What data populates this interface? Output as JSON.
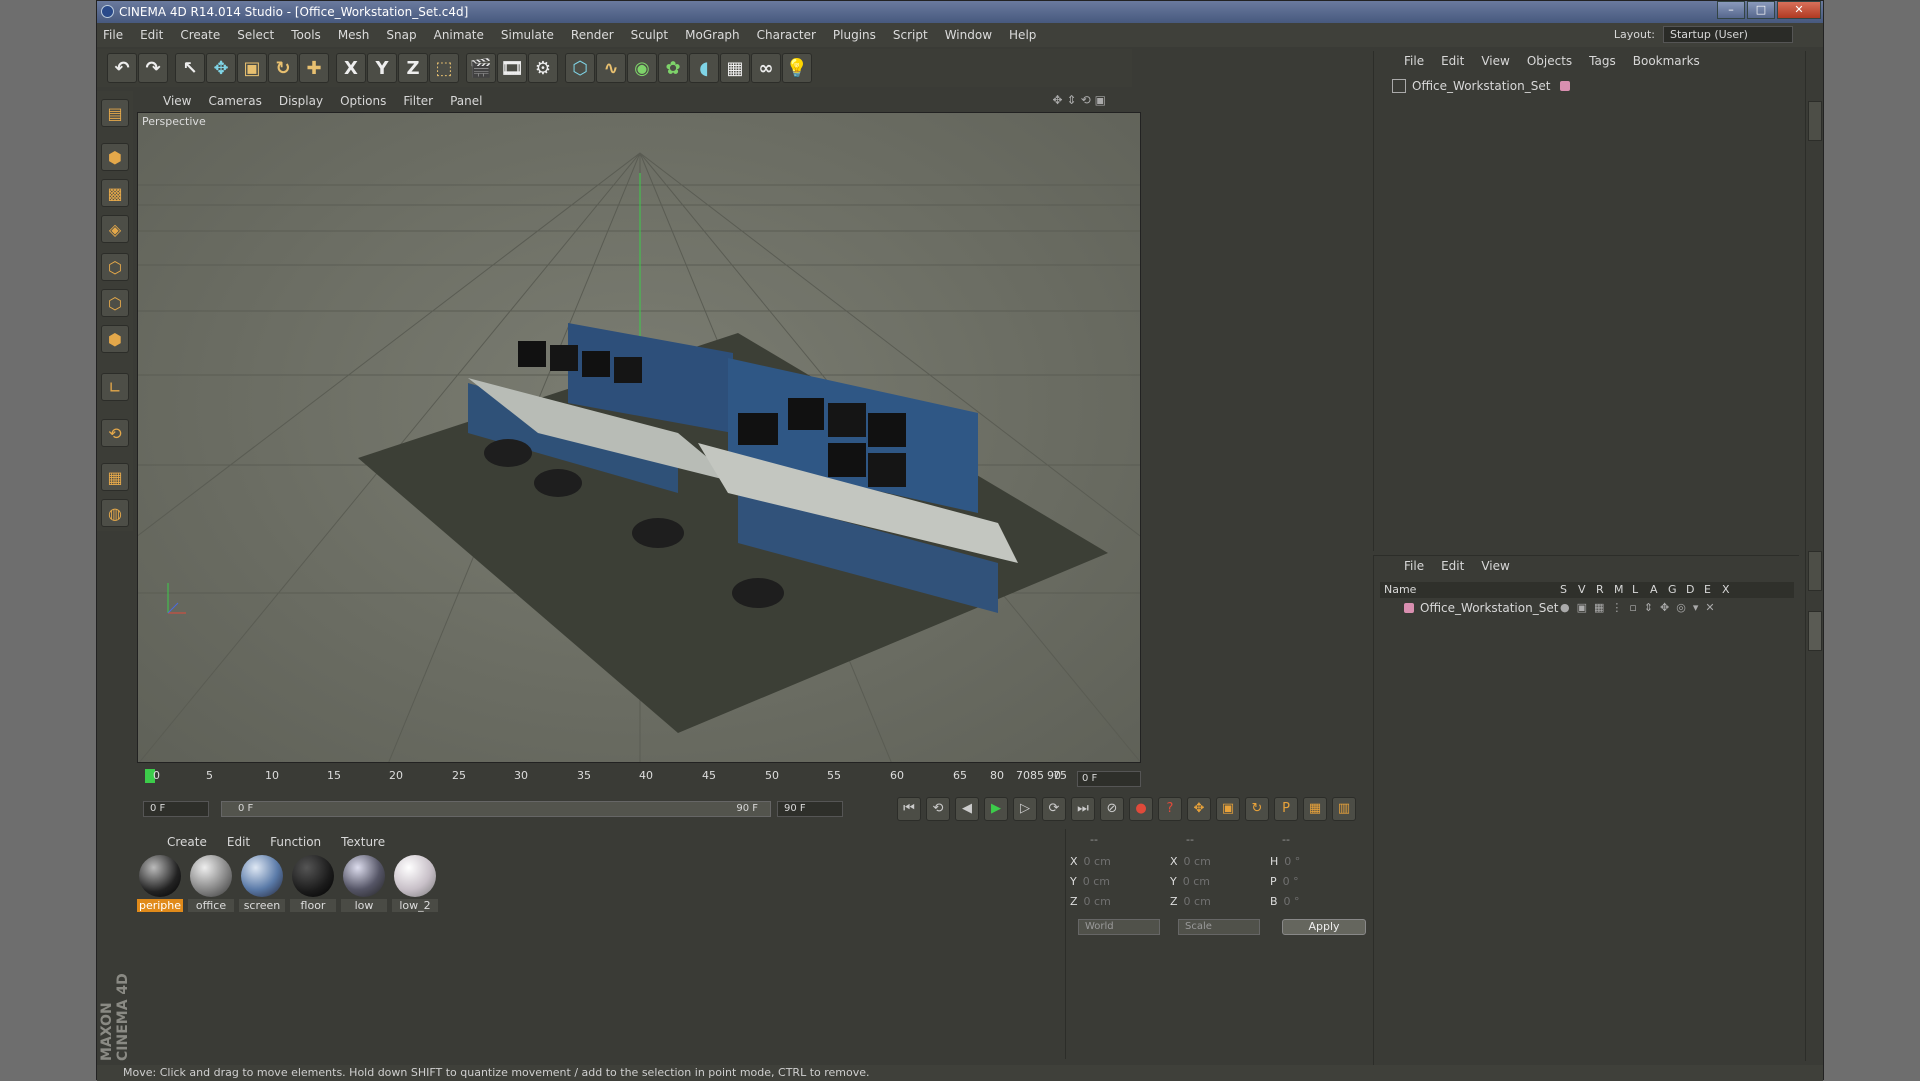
{
  "window": {
    "title": "CINEMA 4D R14.014 Studio - [Office_Workstation_Set.c4d]"
  },
  "menu": [
    "File",
    "Edit",
    "Create",
    "Select",
    "Tools",
    "Mesh",
    "Snap",
    "Animate",
    "Simulate",
    "Render",
    "Sculpt",
    "MoGraph",
    "Character",
    "Plugins",
    "Script",
    "Window",
    "Help"
  ],
  "layout": {
    "label": "Layout:",
    "value": "Startup (User)"
  },
  "toolbar": {
    "x_axis": "X",
    "y_axis": "Y",
    "z_axis": "Z"
  },
  "viewport": {
    "menu": [
      "View",
      "Cameras",
      "Display",
      "Options",
      "Filter",
      "Panel"
    ],
    "label": "Perspective"
  },
  "timeline": {
    "ticks": [
      "0",
      "5",
      "10",
      "15",
      "20",
      "25",
      "30",
      "35",
      "40",
      "45",
      "50",
      "55",
      "60",
      "65",
      "70",
      "75",
      "80",
      "85",
      "90"
    ],
    "current_frame": "0 F"
  },
  "transport": {
    "start": "0 F",
    "range_start": "0 F",
    "range_end": "90 F",
    "end": "90 F"
  },
  "materials_panel": {
    "menu": [
      "Create",
      "Edit",
      "Function",
      "Texture"
    ],
    "items": [
      "periphe",
      "office",
      "screen",
      "floor",
      "low",
      "low_2"
    ]
  },
  "coordinates": {
    "header": [
      "--",
      "--",
      "--"
    ],
    "rows": [
      {
        "a": "X",
        "av": "0 cm",
        "b": "X",
        "bv": "0 cm",
        "c": "H",
        "cv": "0 °"
      },
      {
        "a": "Y",
        "av": "0 cm",
        "b": "Y",
        "bv": "0 cm",
        "c": "P",
        "cv": "0 °"
      },
      {
        "a": "Z",
        "av": "0 cm",
        "b": "Z",
        "bv": "0 cm",
        "c": "B",
        "cv": "0 °"
      }
    ],
    "mode": "World",
    "scale": "Scale",
    "apply": "Apply"
  },
  "objects_panel": {
    "menu": [
      "File",
      "Edit",
      "View",
      "Objects",
      "Tags",
      "Bookmarks"
    ],
    "object_name": "Office_Workstation_Set"
  },
  "layers_panel": {
    "menu": [
      "File",
      "Edit",
      "View"
    ],
    "columns": [
      "Name",
      "S",
      "V",
      "R",
      "M",
      "L",
      "A",
      "G",
      "D",
      "E",
      "X"
    ],
    "layer_name": "Office_Workstation_Set"
  },
  "status": "Move: Click and drag to move elements. Hold down SHIFT to quantize movement / add to the selection in point mode, CTRL to remove.",
  "logo": {
    "line1": "MAXON",
    "line2": "CINEMA 4D"
  }
}
